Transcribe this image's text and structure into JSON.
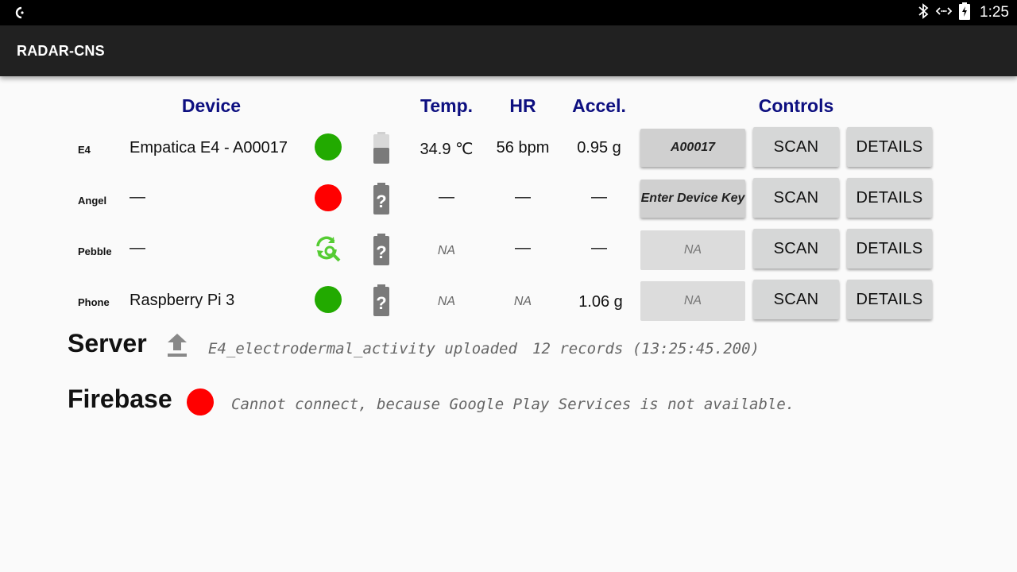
{
  "status_bar": {
    "time": "1:25",
    "icons": [
      "app-icon",
      "bluetooth-icon",
      "data-arrows-icon",
      "battery-charging-icon"
    ]
  },
  "app_bar": {
    "title": "RADAR-CNS"
  },
  "headers": {
    "device": "Device",
    "temp": "Temp.",
    "hr": "HR",
    "accel": "Accel.",
    "controls": "Controls"
  },
  "rows": [
    {
      "label": "E4",
      "name": "Empatica E4 - A00017",
      "status": "connected",
      "status_color": "#22aa00",
      "battery": "battery-level-icon",
      "temp": "34.9 ℃",
      "hr": "56 bpm",
      "accel": "0.95 g",
      "key": "A00017",
      "scan": "SCAN",
      "details": "DETAILS"
    },
    {
      "label": "Angel",
      "name": "—",
      "status": "disconnected",
      "status_color": "#ff0000",
      "battery": "battery-unknown-icon",
      "temp": "—",
      "hr": "—",
      "accel": "—",
      "key": "Enter Device Key",
      "scan": "SCAN",
      "details": "DETAILS"
    },
    {
      "label": "Pebble",
      "name": "—",
      "status": "scanning",
      "status_color": "#55cc33",
      "battery": "battery-unknown-icon",
      "temp": "NA",
      "hr": "—",
      "accel": "—",
      "key": "NA",
      "scan": "SCAN",
      "details": "DETAILS"
    },
    {
      "label": "Phone",
      "name": "Raspberry Pi 3",
      "status": "connected",
      "status_color": "#22aa00",
      "battery": "battery-unknown-icon",
      "temp": "NA",
      "hr": "NA",
      "accel": "1.06 g",
      "key": "NA",
      "scan": "SCAN",
      "details": "DETAILS"
    }
  ],
  "server": {
    "title": "Server",
    "message": "E4_electrodermal_activity uploaded",
    "records": "12 records (13:25:45.200)"
  },
  "firebase": {
    "title": "Firebase",
    "status_color": "#ff0000",
    "message": "Cannot connect, because Google Play Services is not available."
  }
}
